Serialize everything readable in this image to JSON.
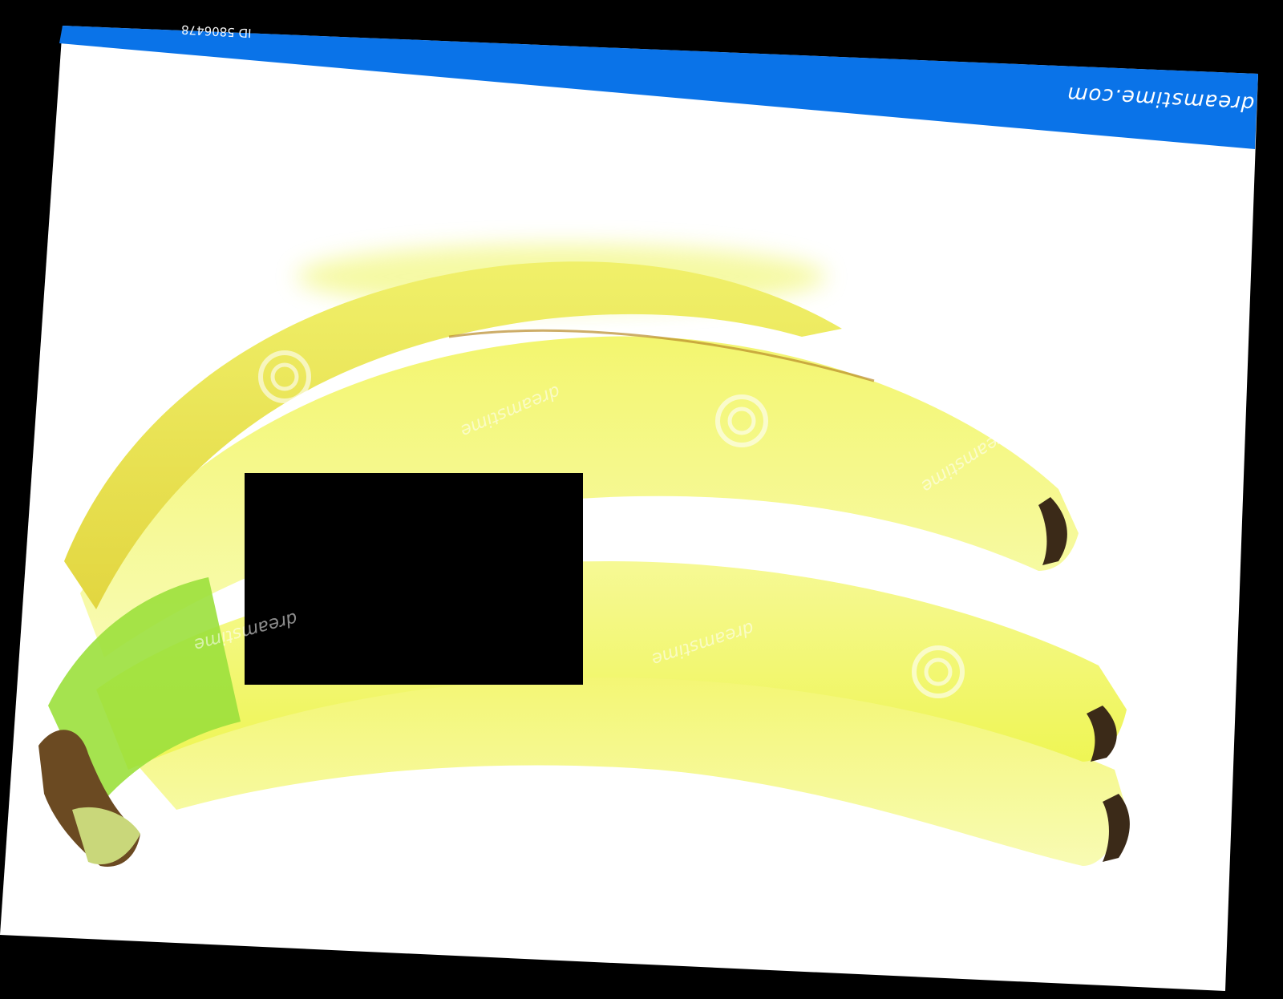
{
  "image": {
    "subject": "banana-bunch",
    "watermark_brand": "dreamstime.com",
    "watermark_repeat": "dreamstime",
    "top_strip_text": "ID 5806478",
    "colors": {
      "background": "#000000",
      "paper": "#ffffff",
      "banner": "#0a73e8",
      "banana_main": "#eef55a",
      "banana_light": "#f6fb9c",
      "banana_ripe": "#e3d83a",
      "stem_green": "#9be03c",
      "stem_brown": "#6b4a22",
      "redaction": "#000000"
    }
  }
}
